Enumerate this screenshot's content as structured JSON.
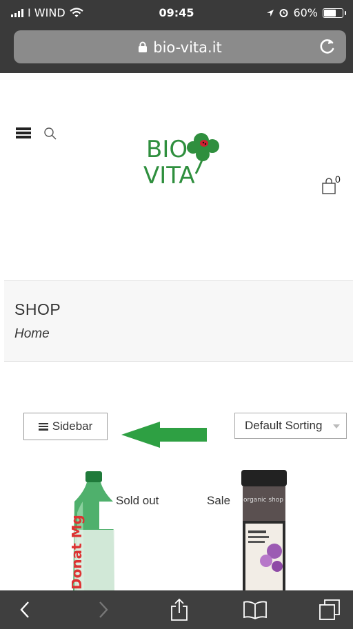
{
  "status_bar": {
    "carrier": "I WIND",
    "time": "09:45",
    "battery": "60%",
    "battery_level": 0.6,
    "icons": [
      "signal-icon",
      "wifi-icon",
      "location-icon",
      "alarm-icon",
      "battery-icon"
    ]
  },
  "browser": {
    "url": "bio-vita.it",
    "icons": [
      "lock-icon",
      "reload-icon"
    ]
  },
  "header": {
    "logo_line1": "BIO",
    "logo_line2": "VITA",
    "cart_count": "0",
    "icons": [
      "menu-icon",
      "search-icon",
      "cart-icon"
    ]
  },
  "shop": {
    "title": "SHOP",
    "breadcrumb": "Home"
  },
  "controls": {
    "sidebar_label": "Sidebar",
    "sort_selected": "Default Sorting"
  },
  "products": [
    {
      "badge": "Sold out",
      "label_text": "Donat Mg"
    },
    {
      "badge": "Sale",
      "label_text": "organic shop"
    }
  ],
  "toolbar": {
    "icons": [
      "back-icon",
      "forward-icon",
      "share-icon",
      "bookmarks-icon",
      "tabs-icon"
    ]
  },
  "colors": {
    "status_bg": "#3a3a3a",
    "url_bar_bg": "#8b8b8b",
    "logo_green": "#2f8f3e",
    "arrow_green": "#2ea043",
    "toolbar_bg": "#3f3f3f"
  }
}
